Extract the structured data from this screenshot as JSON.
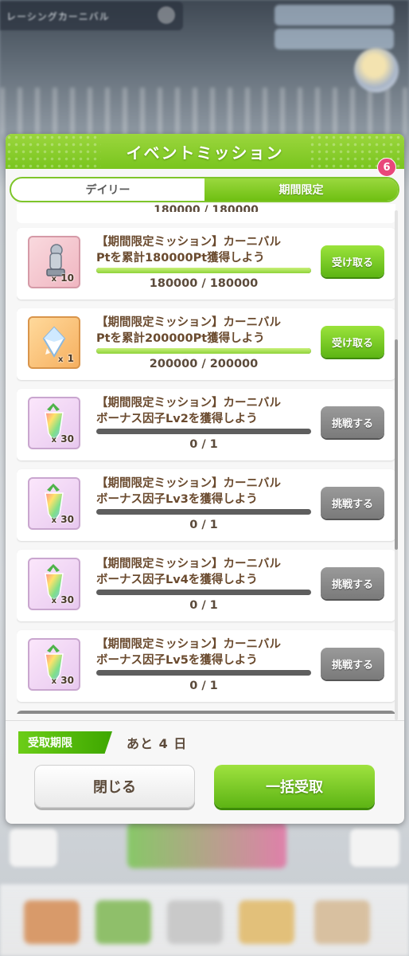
{
  "background": {
    "title": "レーシングカーニバル",
    "info_badge": "i"
  },
  "dialog": {
    "title": "イベントミッション",
    "notice_count": "6",
    "tabs": [
      {
        "label": "デイリー",
        "active": false
      },
      {
        "label": "期間限定",
        "active": true
      }
    ],
    "partial_top_progress": "180000 / 180000",
    "missions": [
      {
        "line1": "【期間限定ミッション】カーニバル",
        "line2": "Ptを累計180000Pt獲得しよう",
        "progress": "180000 / 180000",
        "progress_fraction": 1.0,
        "reward_icon": "whistle-trophy-icon",
        "reward_count": "10",
        "button_label": "受け取る",
        "button_state": "receive"
      },
      {
        "line1": "【期間限定ミッション】カーニバル",
        "line2": "Ptを累計200000Pt獲得しよう",
        "progress": "200000 / 200000",
        "progress_fraction": 1.0,
        "reward_icon": "jewel-icon",
        "reward_count": "1",
        "button_label": "受け取る",
        "button_state": "receive"
      },
      {
        "line1": "【期間限定ミッション】カーニバル",
        "line2": "ボーナス因子Lv2を獲得しよう",
        "progress": "0 / 1",
        "progress_fraction": 0.0,
        "reward_icon": "rainbow-carrot-icon",
        "reward_count": "30",
        "button_label": "挑戦する",
        "button_state": "challenge"
      },
      {
        "line1": "【期間限定ミッション】カーニバル",
        "line2": "ボーナス因子Lv3を獲得しよう",
        "progress": "0 / 1",
        "progress_fraction": 0.0,
        "reward_icon": "rainbow-carrot-icon",
        "reward_count": "30",
        "button_label": "挑戦する",
        "button_state": "challenge"
      },
      {
        "line1": "【期間限定ミッション】カーニバル",
        "line2": "ボーナス因子Lv4を獲得しよう",
        "progress": "0 / 1",
        "progress_fraction": 0.0,
        "reward_icon": "rainbow-carrot-icon",
        "reward_count": "30",
        "button_label": "挑戦する",
        "button_state": "challenge"
      },
      {
        "line1": "【期間限定ミッション】カーニバル",
        "line2": "ボーナス因子Lv5を獲得しよう",
        "progress": "0 / 1",
        "progress_fraction": 0.0,
        "reward_icon": "rainbow-carrot-icon",
        "reward_count": "30",
        "button_label": "挑戦する",
        "button_state": "challenge"
      }
    ],
    "deadline_label": "受取期限",
    "deadline_value": "あと 4 日",
    "close_label": "閉じる",
    "bulk_receive_label": "一括受取"
  },
  "colors": {
    "accent_green": "#79c51e",
    "badge_pink": "#e8487a",
    "text_brown": "#6a4a2e",
    "challenge_gray": "#8a8a8a"
  }
}
